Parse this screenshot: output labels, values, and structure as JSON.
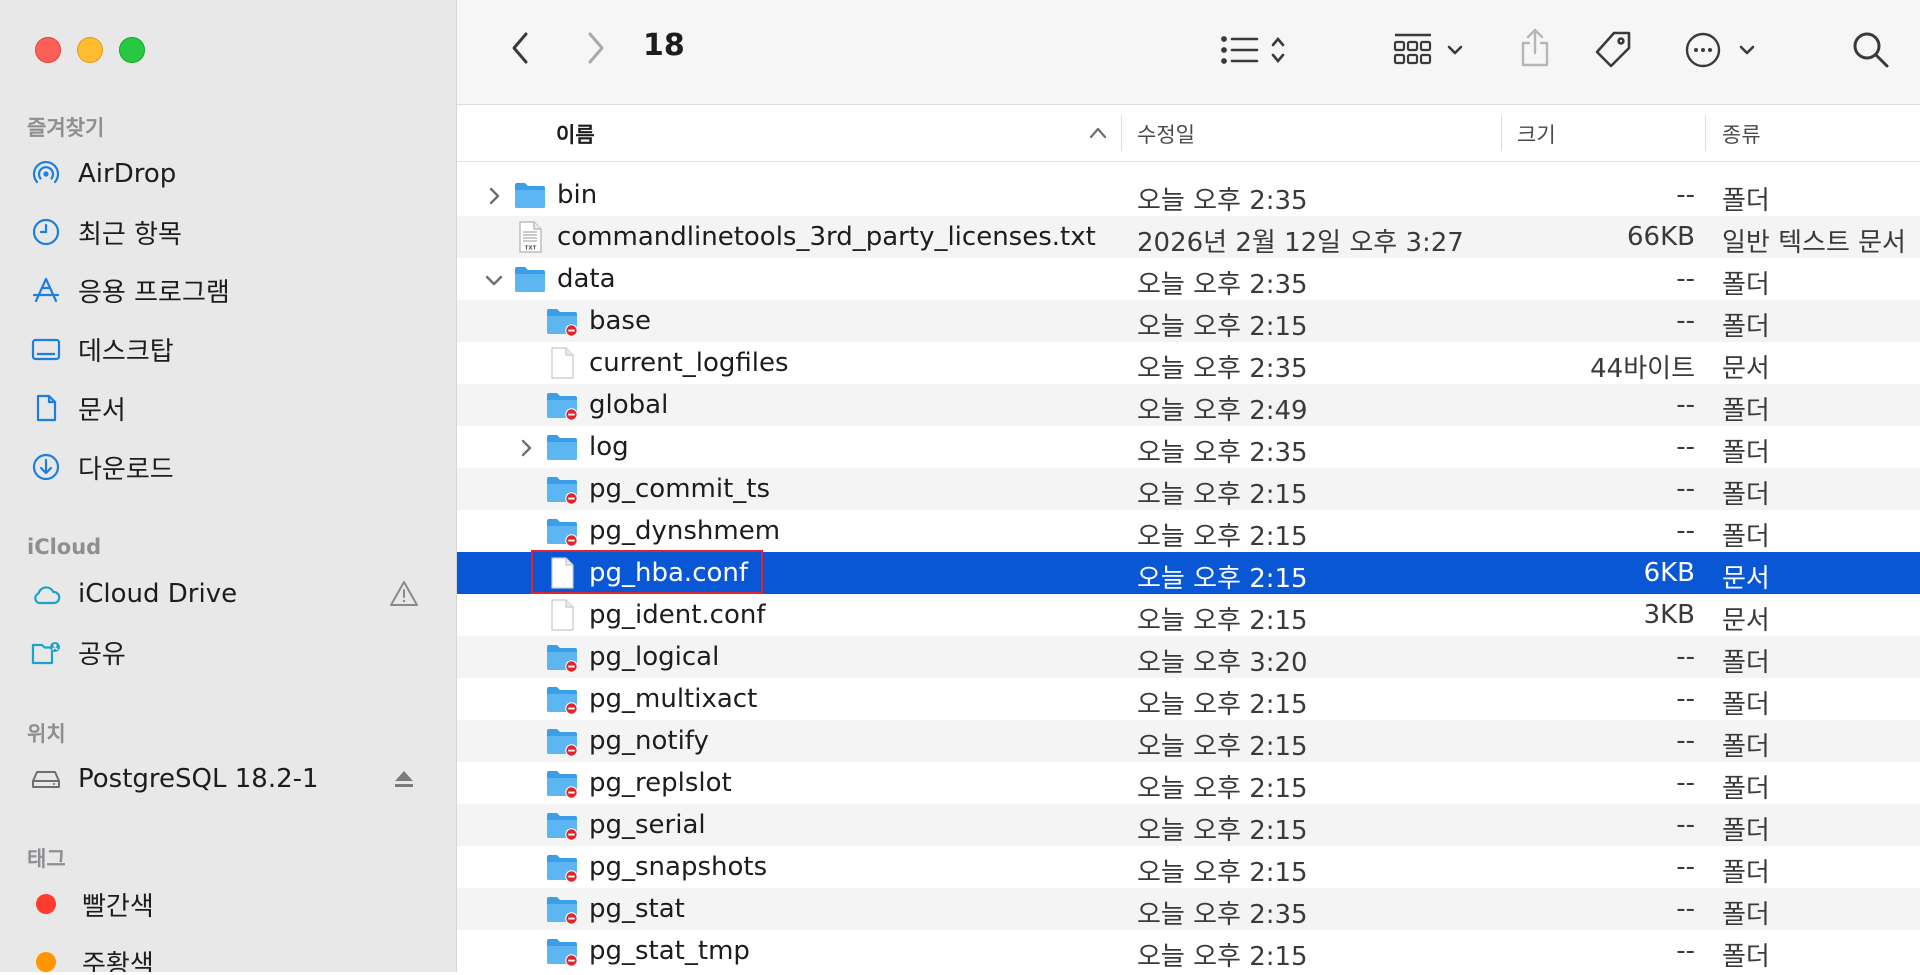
{
  "window": {
    "title": "18"
  },
  "colors": {
    "accent": "#0a57d6",
    "folder": "#3ea2ea",
    "badge": "#e0242b",
    "highlight": "#e0242b"
  },
  "sidebar": {
    "favorites_heading": "즐겨찾기",
    "favorites": [
      {
        "label": "AirDrop",
        "icon": "airdrop-icon"
      },
      {
        "label": "최근 항목",
        "icon": "clock-icon"
      },
      {
        "label": "응용 프로그램",
        "icon": "applications-icon"
      },
      {
        "label": "데스크탑",
        "icon": "desktop-icon"
      },
      {
        "label": "문서",
        "icon": "document-icon"
      },
      {
        "label": "다운로드",
        "icon": "download-icon"
      }
    ],
    "icloud_heading": "iCloud",
    "icloud": [
      {
        "label": "iCloud Drive",
        "icon": "cloud-icon"
      },
      {
        "label": "공유",
        "icon": "shared-folder-icon"
      }
    ],
    "locations_heading": "위치",
    "locations": [
      {
        "label": "PostgreSQL 18.2-1",
        "icon": "disk-icon"
      }
    ],
    "tags_heading": "태그",
    "tags": [
      {
        "label": "빨간색",
        "color": "#ff3b30"
      },
      {
        "label": "주황색",
        "color": "#ff9500"
      }
    ]
  },
  "toolbar": {
    "back_icon": "chevron-left-icon",
    "forward_icon": "chevron-right-icon",
    "list_view_icon": "list-icon",
    "group_icon": "grid-icon",
    "share_icon": "share-icon",
    "tag_icon": "tag-icon",
    "more_icon": "ellipsis-icon",
    "search_icon": "search-icon"
  },
  "columns": {
    "name": "이름",
    "modified": "수정일",
    "size": "크기",
    "kind": "종류"
  },
  "files": [
    {
      "name": "bin",
      "date": "오늘 오후 2:35",
      "size": "--",
      "kind": "폴더",
      "type": "folder",
      "depth": 0,
      "disclosure": "collapsed",
      "locked": false
    },
    {
      "name": "commandlinetools_3rd_party_licenses.txt",
      "date": "2026년 2월 12일 오후 3:27",
      "size": "66KB",
      "kind": "일반 텍스트 문서",
      "type": "txt",
      "depth": 0,
      "disclosure": "none",
      "locked": false
    },
    {
      "name": "data",
      "date": "오늘 오후 2:35",
      "size": "--",
      "kind": "폴더",
      "type": "folder",
      "depth": 0,
      "disclosure": "expanded",
      "locked": false
    },
    {
      "name": "base",
      "date": "오늘 오후 2:15",
      "size": "--",
      "kind": "폴더",
      "type": "folder",
      "depth": 1,
      "disclosure": "none",
      "locked": true
    },
    {
      "name": "current_logfiles",
      "date": "오늘 오후 2:35",
      "size": "44바이트",
      "kind": "문서",
      "type": "file",
      "depth": 1,
      "disclosure": "none",
      "locked": false
    },
    {
      "name": "global",
      "date": "오늘 오후 2:49",
      "size": "--",
      "kind": "폴더",
      "type": "folder",
      "depth": 1,
      "disclosure": "none",
      "locked": true
    },
    {
      "name": "log",
      "date": "오늘 오후 2:35",
      "size": "--",
      "kind": "폴더",
      "type": "folder",
      "depth": 1,
      "disclosure": "collapsed",
      "locked": false
    },
    {
      "name": "pg_commit_ts",
      "date": "오늘 오후 2:15",
      "size": "--",
      "kind": "폴더",
      "type": "folder",
      "depth": 1,
      "disclosure": "none",
      "locked": true
    },
    {
      "name": "pg_dynshmem",
      "date": "오늘 오후 2:15",
      "size": "--",
      "kind": "폴더",
      "type": "folder",
      "depth": 1,
      "disclosure": "none",
      "locked": true
    },
    {
      "name": "pg_hba.conf",
      "date": "오늘 오후 2:15",
      "size": "6KB",
      "kind": "문서",
      "type": "file",
      "depth": 1,
      "disclosure": "none",
      "locked": false,
      "selected": true
    },
    {
      "name": "pg_ident.conf",
      "date": "오늘 오후 2:15",
      "size": "3KB",
      "kind": "문서",
      "type": "file",
      "depth": 1,
      "disclosure": "none",
      "locked": false
    },
    {
      "name": "pg_logical",
      "date": "오늘 오후 3:20",
      "size": "--",
      "kind": "폴더",
      "type": "folder",
      "depth": 1,
      "disclosure": "none",
      "locked": true
    },
    {
      "name": "pg_multixact",
      "date": "오늘 오후 2:15",
      "size": "--",
      "kind": "폴더",
      "type": "folder",
      "depth": 1,
      "disclosure": "none",
      "locked": true
    },
    {
      "name": "pg_notify",
      "date": "오늘 오후 2:15",
      "size": "--",
      "kind": "폴더",
      "type": "folder",
      "depth": 1,
      "disclosure": "none",
      "locked": true
    },
    {
      "name": "pg_replslot",
      "date": "오늘 오후 2:15",
      "size": "--",
      "kind": "폴더",
      "type": "folder",
      "depth": 1,
      "disclosure": "none",
      "locked": true
    },
    {
      "name": "pg_serial",
      "date": "오늘 오후 2:15",
      "size": "--",
      "kind": "폴더",
      "type": "folder",
      "depth": 1,
      "disclosure": "none",
      "locked": true
    },
    {
      "name": "pg_snapshots",
      "date": "오늘 오후 2:15",
      "size": "--",
      "kind": "폴더",
      "type": "folder",
      "depth": 1,
      "disclosure": "none",
      "locked": true
    },
    {
      "name": "pg_stat",
      "date": "오늘 오후 2:35",
      "size": "--",
      "kind": "폴더",
      "type": "folder",
      "depth": 1,
      "disclosure": "none",
      "locked": true
    },
    {
      "name": "pg_stat_tmp",
      "date": "오늘 오후 2:15",
      "size": "--",
      "kind": "폴더",
      "type": "folder",
      "depth": 1,
      "disclosure": "none",
      "locked": true
    }
  ]
}
